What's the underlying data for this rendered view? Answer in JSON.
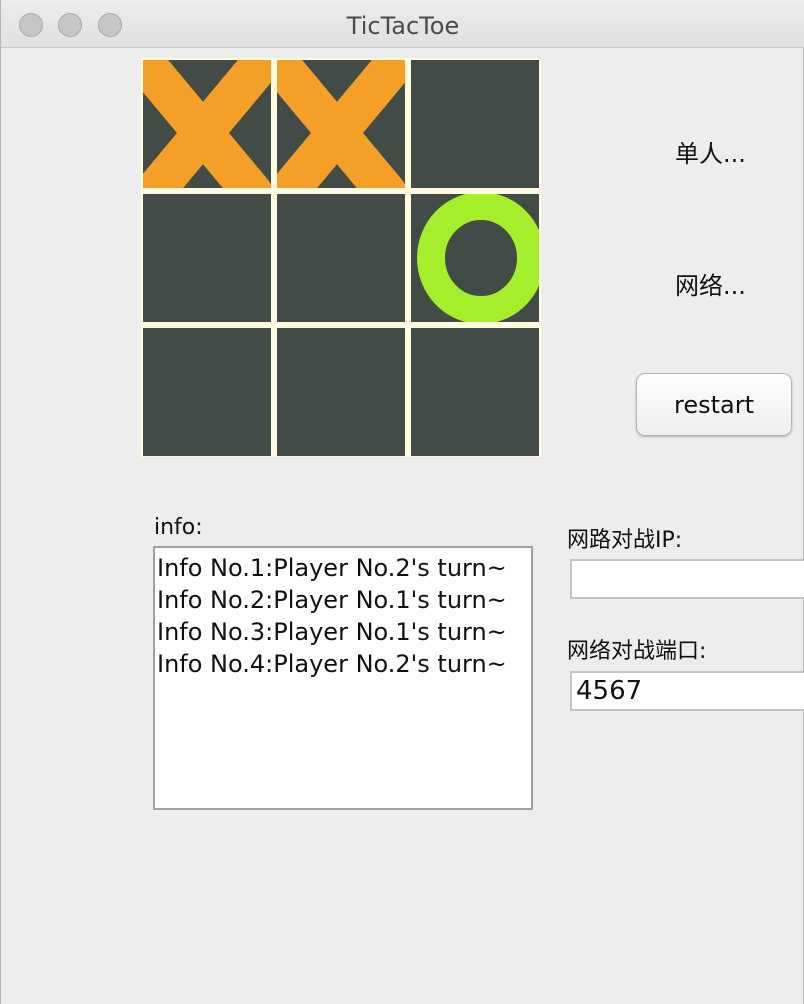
{
  "window": {
    "title": "TicTacToe"
  },
  "board": {
    "cells": [
      "X",
      "X",
      "",
      "",
      "",
      "O",
      "",
      "",
      ""
    ]
  },
  "side": {
    "single_label": "单人...",
    "network_label": "网络...",
    "restart_label": "restart"
  },
  "info": {
    "label": "info:",
    "lines": [
      "Info No.1:Player No.2's turn~",
      "Info No.2:Player No.1's turn~",
      "Info No.3:Player No.1's turn~",
      "Info No.4:Player No.2's turn~"
    ]
  },
  "network": {
    "ip_label": "网路对战IP:",
    "ip_value": "",
    "port_label": "网络对战端口:",
    "port_value": "4567"
  },
  "colors": {
    "x_color": "#f4a028",
    "o_color": "#a5ee2c",
    "cell_bg": "#424b45",
    "grid_line": "#fffbe0"
  }
}
